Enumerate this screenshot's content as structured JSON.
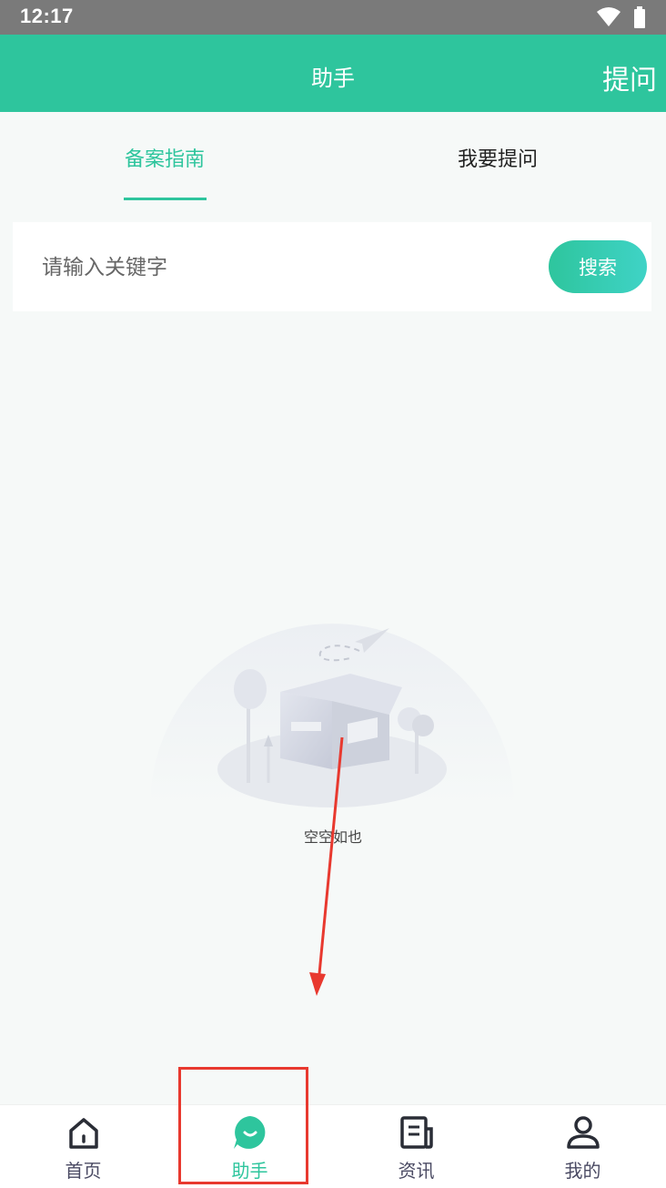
{
  "status_bar": {
    "time": "12:17",
    "icons": [
      "wifi-icon",
      "battery-icon"
    ]
  },
  "header": {
    "title": "助手",
    "action_label": "提问",
    "color": "#2ec59d"
  },
  "tabs": [
    {
      "label": "备案指南",
      "active": true
    },
    {
      "label": "我要提问",
      "active": false
    }
  ],
  "search": {
    "placeholder": "请输入关键字",
    "value": "",
    "button_label": "搜索"
  },
  "empty_state": {
    "text": "空空如也",
    "illustration": "empty-box-illustration"
  },
  "bottom_nav": [
    {
      "label": "首页",
      "icon": "home-icon",
      "active": false
    },
    {
      "label": "助手",
      "icon": "assistant-chat-icon",
      "active": true
    },
    {
      "label": "资讯",
      "icon": "news-icon",
      "active": false
    },
    {
      "label": "我的",
      "icon": "user-icon",
      "active": false
    }
  ],
  "annotation": {
    "color": "#e8392f",
    "arrow": "down-arrow",
    "highlight_target": "助手"
  }
}
